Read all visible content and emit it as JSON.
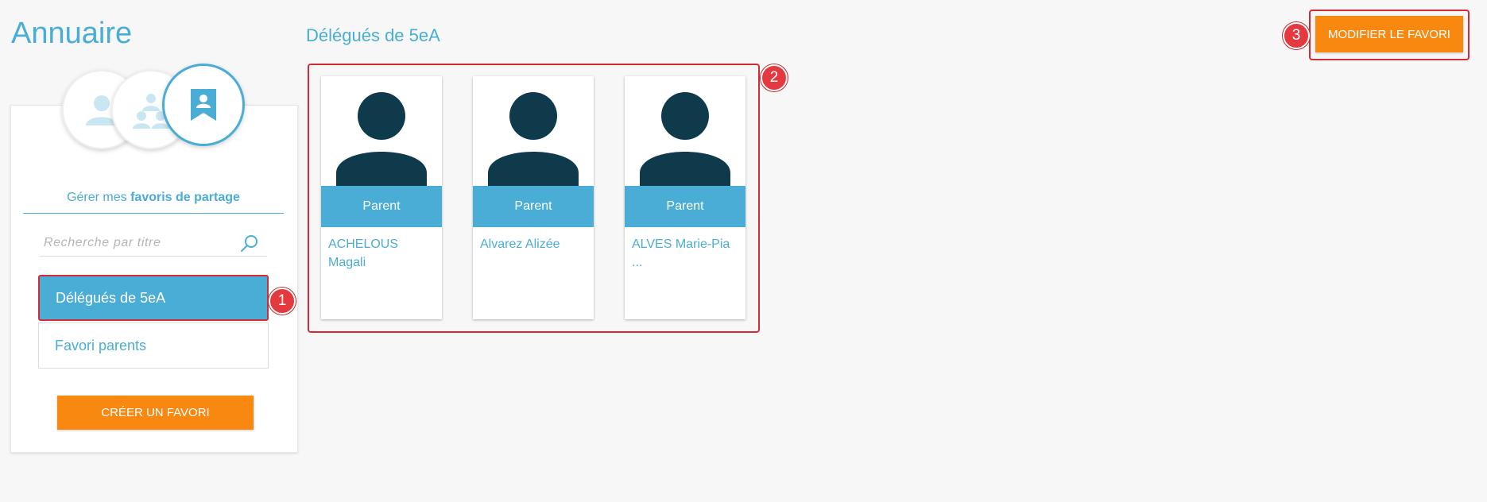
{
  "app": {
    "title": "Annuaire"
  },
  "sidebar": {
    "mode_icons": [
      "person-icon",
      "groups-icon",
      "bookmark-person-icon"
    ],
    "manage_prefix": "Gérer mes ",
    "manage_bold": "favoris de partage",
    "search": {
      "placeholder": "Recherche par titre",
      "value": ""
    },
    "favorites": [
      {
        "label": "Délégués de 5eA",
        "active": true
      },
      {
        "label": "Favori parents",
        "active": false
      }
    ],
    "create_button": "CRÉER UN FAVORI"
  },
  "group": {
    "title": "Délégués de 5eA",
    "members": [
      {
        "role": "Parent",
        "name": "ACHELOUS\nMagali"
      },
      {
        "role": "Parent",
        "name": "Alvarez Alizée"
      },
      {
        "role": "Parent",
        "name": "ALVES Marie-Pia ..."
      }
    ]
  },
  "toolbar": {
    "edit_button": "MODIFIER LE FAVORI"
  },
  "callouts": [
    "1",
    "2",
    "3"
  ],
  "colors": {
    "accent": "#4aadd6",
    "action": "#f8880f",
    "highlight": "#d62b36",
    "avatar": "#0f3a4c"
  }
}
